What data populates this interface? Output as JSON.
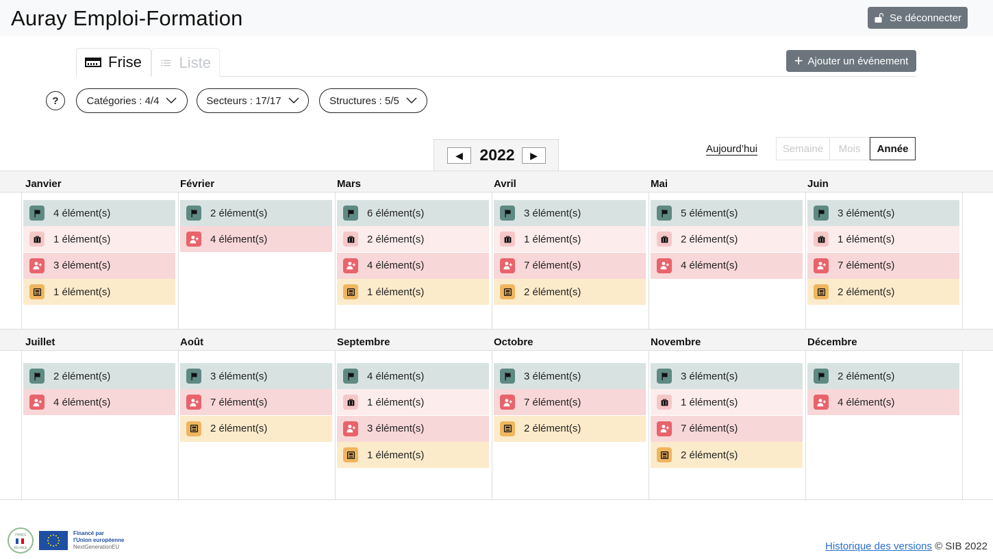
{
  "header": {
    "app_title": "Auray Emploi-Formation",
    "logout_label": "Se déconnecter"
  },
  "tabs": [
    {
      "label": "Frise",
      "active": true
    },
    {
      "label": "Liste",
      "active": false
    }
  ],
  "add_event_label": "Ajouter un événement",
  "filters": {
    "help": "?",
    "categories": "Catégories : 4/4",
    "secteurs": "Secteurs : 17/17",
    "structures": "Structures : 5/5"
  },
  "calendar": {
    "year": "2022",
    "prev": "◀",
    "next": "▶",
    "today_label": "Aujourd’hui",
    "views": [
      "Semaine",
      "Mois",
      "Année"
    ],
    "active_view": "Année",
    "months": [
      {
        "name": "Janvier",
        "items": [
          [
            "flag",
            "4 élément(s)"
          ],
          [
            "case",
            "1 élément(s)"
          ],
          [
            "user",
            "3 élément(s)"
          ],
          [
            "news",
            "1 élément(s)"
          ]
        ]
      },
      {
        "name": "Février",
        "items": [
          [
            "flag",
            "2 élément(s)"
          ],
          [
            "user",
            "4 élément(s)"
          ]
        ]
      },
      {
        "name": "Mars",
        "items": [
          [
            "flag",
            "6 élément(s)"
          ],
          [
            "case",
            "2 élément(s)"
          ],
          [
            "user",
            "4 élément(s)"
          ],
          [
            "news",
            "1 élément(s)"
          ]
        ]
      },
      {
        "name": "Avril",
        "items": [
          [
            "flag",
            "3 élément(s)"
          ],
          [
            "case",
            "1 élément(s)"
          ],
          [
            "user",
            "7 élément(s)"
          ],
          [
            "news",
            "2 élément(s)"
          ]
        ]
      },
      {
        "name": "Mai",
        "items": [
          [
            "flag",
            "5 élément(s)"
          ],
          [
            "case",
            "2 élément(s)"
          ],
          [
            "user",
            "4 élément(s)"
          ]
        ]
      },
      {
        "name": "Juin",
        "items": [
          [
            "flag",
            "3 élément(s)"
          ],
          [
            "case",
            "1 élément(s)"
          ],
          [
            "user",
            "7 élément(s)"
          ],
          [
            "news",
            "2 élément(s)"
          ]
        ]
      },
      {
        "name": "Juillet",
        "items": [
          [
            "flag",
            "2 élément(s)"
          ],
          [
            "user",
            "4 élément(s)"
          ]
        ]
      },
      {
        "name": "Août",
        "items": [
          [
            "flag",
            "3 élément(s)"
          ],
          [
            "user",
            "7 élément(s)"
          ],
          [
            "news",
            "2 élément(s)"
          ]
        ]
      },
      {
        "name": "Septembre",
        "items": [
          [
            "flag",
            "4 élément(s)"
          ],
          [
            "case",
            "1 élément(s)"
          ],
          [
            "user",
            "3 élément(s)"
          ],
          [
            "news",
            "1 élément(s)"
          ]
        ]
      },
      {
        "name": "Octobre",
        "items": [
          [
            "flag",
            "3 élément(s)"
          ],
          [
            "user",
            "7 élément(s)"
          ],
          [
            "news",
            "2 élément(s)"
          ]
        ]
      },
      {
        "name": "Novembre",
        "items": [
          [
            "flag",
            "3 élément(s)"
          ],
          [
            "case",
            "1 élément(s)"
          ],
          [
            "user",
            "7 élément(s)"
          ],
          [
            "news",
            "2 élément(s)"
          ]
        ]
      },
      {
        "name": "Décembre",
        "items": [
          [
            "flag",
            "2 élément(s)"
          ],
          [
            "user",
            "4 élément(s)"
          ]
        ]
      }
    ]
  },
  "footer": {
    "eu_line1": "Financé par",
    "eu_line2": "l'Union européenne",
    "eu_line3": "NextGenerationEU",
    "fr_logo": "FRANCE RELANCE",
    "versions_link": "Historique des versions",
    "copyright": "© SIB 2022"
  }
}
